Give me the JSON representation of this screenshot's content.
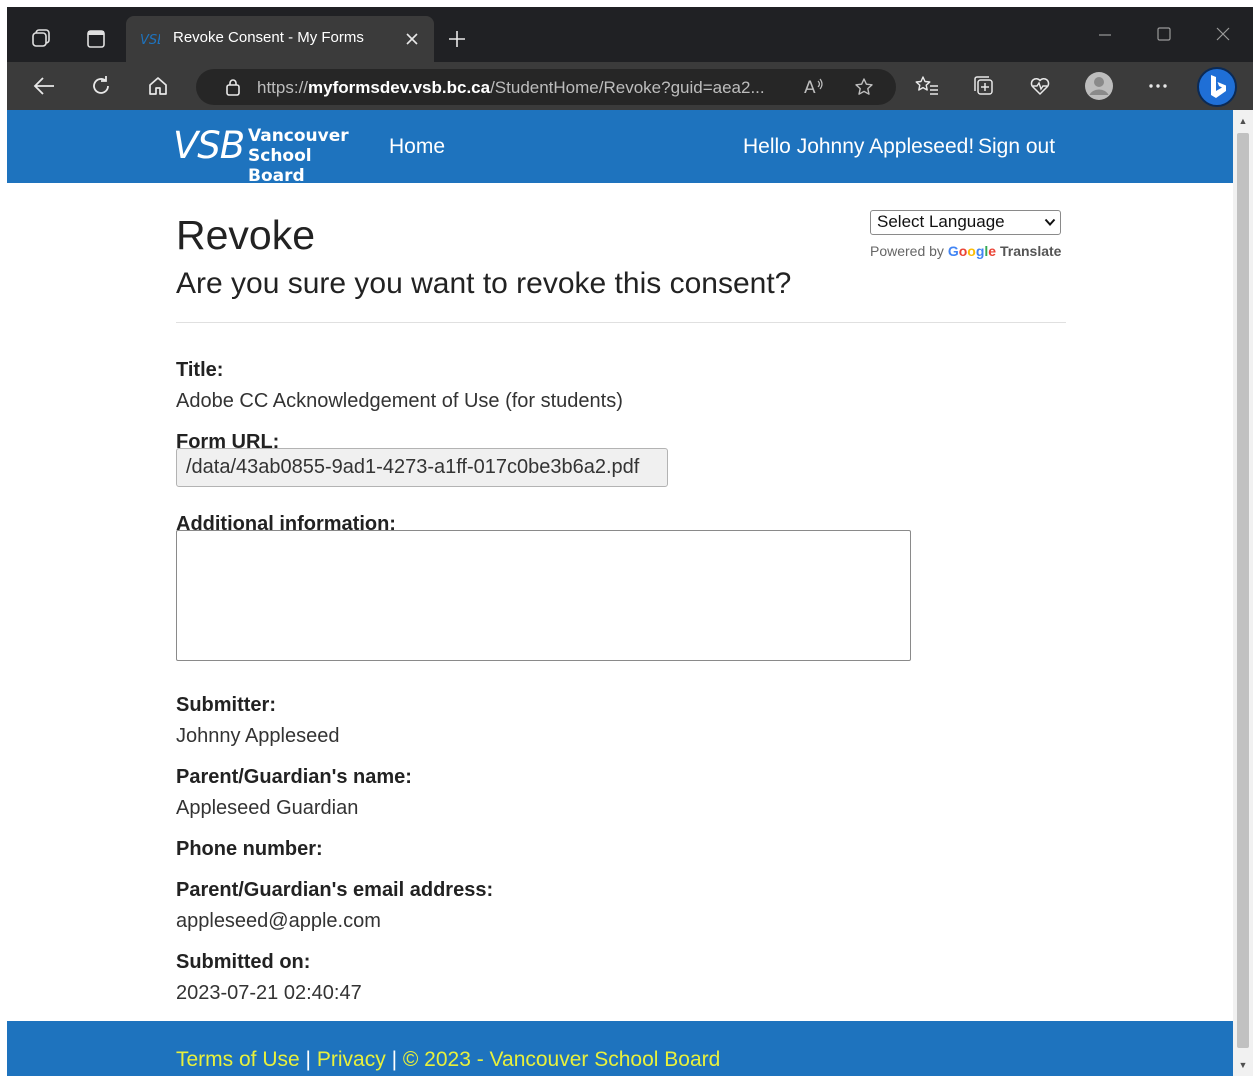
{
  "browser": {
    "tab_title": "Revoke Consent - My Forms",
    "url_prefix": "https://",
    "url_host": "myformsdev.vsb.bc.ca",
    "url_path": "/StudentHome/Revoke?guid=aea2...",
    "icons": {
      "workspaces": "workspaces-icon",
      "tab_actions": "tab-actions-icon",
      "new_tab": "plus-icon",
      "back": "back-arrow-icon",
      "refresh": "refresh-icon",
      "home": "home-icon",
      "site_info": "lock-icon",
      "read_aloud": "read-aloud-icon",
      "favorite": "star-icon",
      "favorites": "favorites-list-icon",
      "collections": "collections-icon",
      "browser_essentials": "heart-pulse-icon",
      "profile": "profile-icon",
      "more": "more-icon",
      "copilot": "bing-icon"
    }
  },
  "site": {
    "logo_mark": "VSB",
    "logo_line1": "Vancouver",
    "logo_line2": "School Board",
    "nav_home": "Home",
    "greeting": "Hello Johnny Appleseed!",
    "sign_out": "Sign out",
    "brand_color": "#1e73be",
    "footer_link_color": "#e8f03c"
  },
  "page": {
    "title": "Revoke",
    "question": "Are you sure you want to revoke this consent?",
    "language_select": "Select Language",
    "powered_by": "Powered by",
    "google": "Google",
    "translate": "Translate"
  },
  "details": {
    "title_label": "Title:",
    "title_value": "Adobe CC Acknowledgement of Use (for students)",
    "form_url_label": "Form URL:",
    "form_url_value": "/data/43ab0855-9ad1-4273-a1ff-017c0be3b6a2.pdf",
    "additional_info_label": "Additional information:",
    "additional_info_value": "",
    "submitter_label": "Submitter:",
    "submitter_value": "Johnny Appleseed",
    "guardian_name_label": "Parent/Guardian's name:",
    "guardian_name_value": "Appleseed Guardian",
    "phone_label": "Phone number:",
    "guardian_email_label": "Parent/Guardian's email address:",
    "guardian_email_value": "appleseed@apple.com",
    "submitted_on_label": "Submitted on:",
    "submitted_on_value": "2023-07-21 02:40:47"
  },
  "footer": {
    "terms": "Terms of Use",
    "separator": "|",
    "privacy": "Privacy",
    "copyright": "© 2023 - Vancouver School Board"
  }
}
